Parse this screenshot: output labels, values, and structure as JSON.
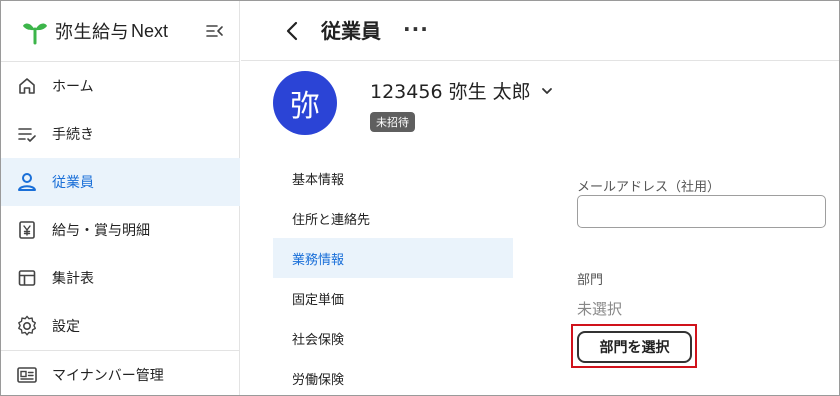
{
  "brand": {
    "name": "弥生給与",
    "suffix": "Next"
  },
  "sidebar": {
    "items": [
      {
        "label": "ホーム"
      },
      {
        "label": "手続き"
      },
      {
        "label": "従業員"
      },
      {
        "label": "給与・賞与明細"
      },
      {
        "label": "集計表"
      },
      {
        "label": "設定"
      },
      {
        "label": "マイナンバー管理"
      }
    ]
  },
  "header": {
    "title": "従業員",
    "more": "···"
  },
  "employee": {
    "avatar_char": "弥",
    "name": "123456 弥生 太郎",
    "status_badge": "未招待"
  },
  "subnav": {
    "items": [
      {
        "label": "基本情報"
      },
      {
        "label": "住所と連絡先"
      },
      {
        "label": "業務情報"
      },
      {
        "label": "固定単価"
      },
      {
        "label": "社会保険"
      },
      {
        "label": "労働保険"
      }
    ]
  },
  "form": {
    "email_label": "メールアドレス（社用）",
    "email_value": "",
    "department_label": "部門",
    "department_value": "未選択",
    "select_department_button": "部門を選択"
  },
  "colors": {
    "accent": "#1a6fd8",
    "avatar_bg": "#2b44d6",
    "highlight": "#d0121b",
    "active_bg": "#eaf3fb",
    "logo_green": "#3cb54a"
  }
}
